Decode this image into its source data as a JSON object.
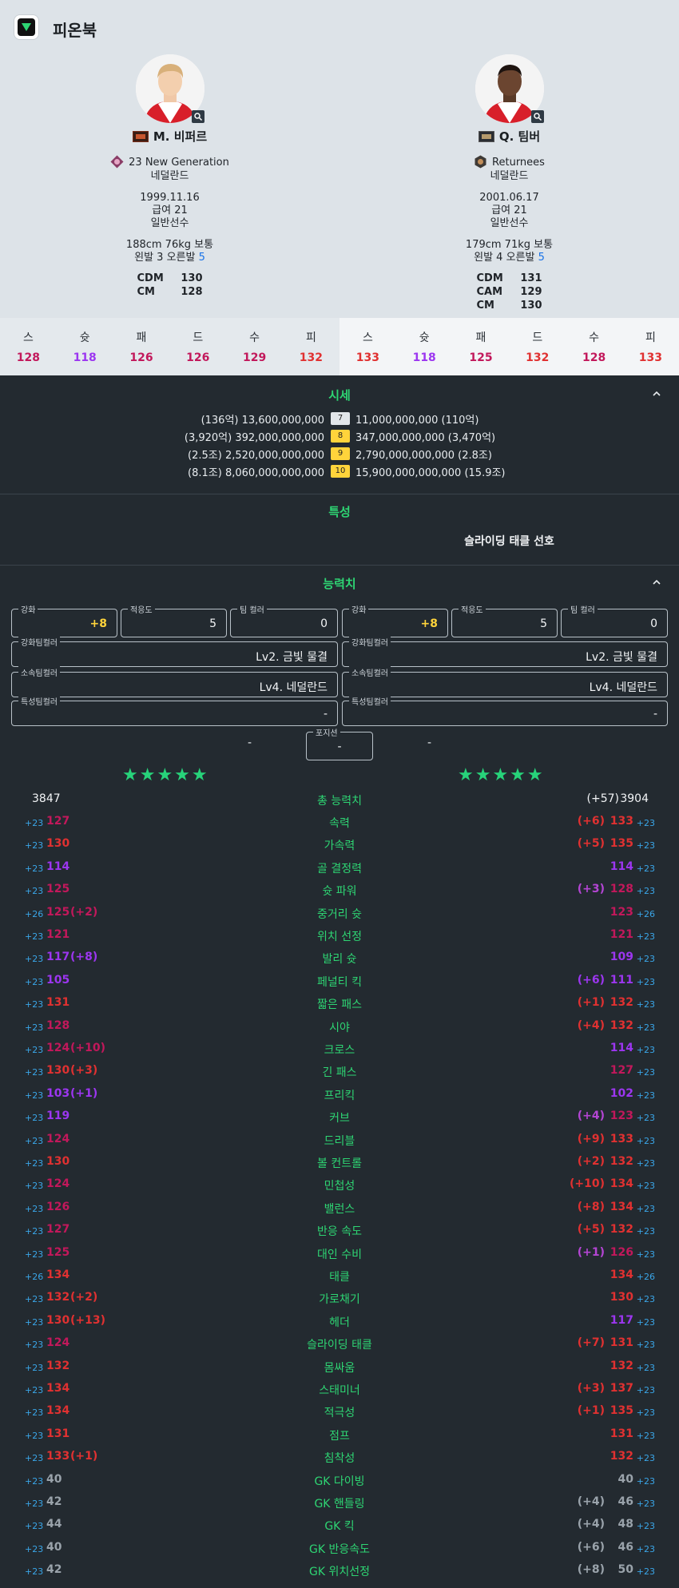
{
  "app": {
    "title": "피온북"
  },
  "colors": {
    "accent": "#2ed573",
    "red": "#e03131",
    "purple": "#b445d4",
    "pink": "#c2185b",
    "violet": "#9c36f0",
    "blue": "#3aa6e8",
    "yellow": "#ffd43b"
  },
  "players": [
    {
      "name": "M. 비퍼르",
      "season": "23 New Generation",
      "nation": "네덜란드",
      "birth": "1999.11.16",
      "salary": "급여 21",
      "grade": "일반선수",
      "body": "188cm 76kg 보통",
      "foot_prefix": "왼발 3 오른발",
      "foot_strong": "5",
      "positions": [
        {
          "pos": "CDM",
          "ovr": "130"
        },
        {
          "pos": "CM",
          "ovr": "128"
        }
      ],
      "stats": [
        {
          "label": "스",
          "value": "128",
          "color": "#c2185b"
        },
        {
          "label": "슛",
          "value": "118",
          "color": "#9c36f0"
        },
        {
          "label": "패",
          "value": "126",
          "color": "#c2185b"
        },
        {
          "label": "드",
          "value": "126",
          "color": "#c2185b"
        },
        {
          "label": "수",
          "value": "129",
          "color": "#c2185b"
        },
        {
          "label": "피",
          "value": "132",
          "color": "#e03131"
        }
      ]
    },
    {
      "name": "Q. 팀버",
      "season": "Returnees",
      "nation": "네덜란드",
      "birth": "2001.06.17",
      "salary": "급여 21",
      "grade": "일반선수",
      "body": "179cm 71kg 보통",
      "foot_prefix": "왼발 4 오른발",
      "foot_strong": "5",
      "positions": [
        {
          "pos": "CDM",
          "ovr": "131"
        },
        {
          "pos": "CAM",
          "ovr": "129"
        },
        {
          "pos": "CM",
          "ovr": "130"
        }
      ],
      "stats": [
        {
          "label": "스",
          "value": "133",
          "color": "#e03131"
        },
        {
          "label": "슛",
          "value": "118",
          "color": "#9c36f0"
        },
        {
          "label": "패",
          "value": "125",
          "color": "#c2185b"
        },
        {
          "label": "드",
          "value": "132",
          "color": "#e03131"
        },
        {
          "label": "수",
          "value": "128",
          "color": "#c2185b"
        },
        {
          "label": "피",
          "value": "133",
          "color": "#e03131"
        }
      ]
    }
  ],
  "price": {
    "title": "시세",
    "rows": [
      {
        "left": "(136억) 13,600,000,000",
        "level": "7",
        "right": "11,000,000,000 (110억)"
      },
      {
        "left": "(3,920억) 392,000,000,000",
        "level": "8",
        "right": "347,000,000,000 (3,470억)"
      },
      {
        "left": "(2.5조) 2,520,000,000,000",
        "level": "9",
        "right": "2,790,000,000,000 (2.8조)"
      },
      {
        "left": "(8.1조) 8,060,000,000,000",
        "level": "10",
        "right": "15,900,000,000,000 (15.9조)"
      }
    ]
  },
  "traits": {
    "title": "특성",
    "right_trait": "슬라이딩 태클 선호"
  },
  "abilities": {
    "title": "능력치",
    "fields": {
      "enhance_label": "강화",
      "enhance_value": "+8",
      "adapt_label": "적응도",
      "adapt_value": "5",
      "teamcolor_label": "팀 컬러",
      "teamcolor_value": "0",
      "enh_team_label": "강화팀컬러",
      "enh_team_value": "Lv2. 금빛 물결",
      "club_team_label": "소속팀컬러",
      "club_team_value": "Lv4. 네덜란드",
      "trait_team_label": "특성팀컬러",
      "trait_team_value": "-",
      "position_label": "포지션",
      "position_value": "-",
      "side_value": "-"
    },
    "stars": "★★★★★",
    "total": {
      "label": "총 능력치",
      "left": "3847",
      "right_bonus": "(+57)",
      "right": "3904"
    },
    "rows": [
      {
        "name": "속력",
        "lp": "+23",
        "lv": "127",
        "lc": "#c2185b",
        "lb": "",
        "lbc": "",
        "rb": "(+6)",
        "rbc": "#e03131",
        "rv": "133",
        "rc": "#e03131",
        "rp": "+23"
      },
      {
        "name": "가속력",
        "lp": "+23",
        "lv": "130",
        "lc": "#e03131",
        "lb": "",
        "lbc": "",
        "rb": "(+5)",
        "rbc": "#e03131",
        "rv": "135",
        "rc": "#e03131",
        "rp": "+23"
      },
      {
        "name": "골 결정력",
        "lp": "+23",
        "lv": "114",
        "lc": "#9c36f0",
        "lb": "",
        "lbc": "",
        "rb": "",
        "rbc": "",
        "rv": "114",
        "rc": "#9c36f0",
        "rp": "+23"
      },
      {
        "name": "슛 파워",
        "lp": "+23",
        "lv": "125",
        "lc": "#c2185b",
        "lb": "",
        "lbc": "",
        "rb": "(+3)",
        "rbc": "#b445d4",
        "rv": "128",
        "rc": "#c2185b",
        "rp": "+23"
      },
      {
        "name": "중거리 슛",
        "lp": "+26",
        "lv": "125",
        "lc": "#c2185b",
        "lb": "(+2)",
        "lbc": "#c2185b",
        "rb": "",
        "rbc": "",
        "rv": "123",
        "rc": "#c2185b",
        "rp": "+26"
      },
      {
        "name": "위치 선정",
        "lp": "+23",
        "lv": "121",
        "lc": "#c2185b",
        "lb": "",
        "lbc": "",
        "rb": "",
        "rbc": "",
        "rv": "121",
        "rc": "#c2185b",
        "rp": "+23"
      },
      {
        "name": "발리 슛",
        "lp": "+23",
        "lv": "117",
        "lc": "#9c36f0",
        "lb": "(+8)",
        "lbc": "#9c36f0",
        "rb": "",
        "rbc": "",
        "rv": "109",
        "rc": "#9c36f0",
        "rp": "+23"
      },
      {
        "name": "페널티 킥",
        "lp": "+23",
        "lv": "105",
        "lc": "#9c36f0",
        "lb": "",
        "lbc": "",
        "rb": "(+6)",
        "rbc": "#9c36f0",
        "rv": "111",
        "rc": "#9c36f0",
        "rp": "+23"
      },
      {
        "name": "짧은 패스",
        "lp": "+23",
        "lv": "131",
        "lc": "#e03131",
        "lb": "",
        "lbc": "",
        "rb": "(+1)",
        "rbc": "#e03131",
        "rv": "132",
        "rc": "#e03131",
        "rp": "+23"
      },
      {
        "name": "시야",
        "lp": "+23",
        "lv": "128",
        "lc": "#c2185b",
        "lb": "",
        "lbc": "",
        "rb": "(+4)",
        "rbc": "#e03131",
        "rv": "132",
        "rc": "#e03131",
        "rp": "+23"
      },
      {
        "name": "크로스",
        "lp": "+23",
        "lv": "124",
        "lc": "#c2185b",
        "lb": "(+10)",
        "lbc": "#c2185b",
        "rb": "",
        "rbc": "",
        "rv": "114",
        "rc": "#9c36f0",
        "rp": "+23"
      },
      {
        "name": "긴 패스",
        "lp": "+23",
        "lv": "130",
        "lc": "#e03131",
        "lb": "(+3)",
        "lbc": "#e03131",
        "rb": "",
        "rbc": "",
        "rv": "127",
        "rc": "#c2185b",
        "rp": "+23"
      },
      {
        "name": "프리킥",
        "lp": "+23",
        "lv": "103",
        "lc": "#9c36f0",
        "lb": "(+1)",
        "lbc": "#9c36f0",
        "rb": "",
        "rbc": "",
        "rv": "102",
        "rc": "#9c36f0",
        "rp": "+23"
      },
      {
        "name": "커브",
        "lp": "+23",
        "lv": "119",
        "lc": "#9c36f0",
        "lb": "",
        "lbc": "",
        "rb": "(+4)",
        "rbc": "#b445d4",
        "rv": "123",
        "rc": "#c2185b",
        "rp": "+23"
      },
      {
        "name": "드리블",
        "lp": "+23",
        "lv": "124",
        "lc": "#c2185b",
        "lb": "",
        "lbc": "",
        "rb": "(+9)",
        "rbc": "#e03131",
        "rv": "133",
        "rc": "#e03131",
        "rp": "+23"
      },
      {
        "name": "볼 컨트롤",
        "lp": "+23",
        "lv": "130",
        "lc": "#e03131",
        "lb": "",
        "lbc": "",
        "rb": "(+2)",
        "rbc": "#e03131",
        "rv": "132",
        "rc": "#e03131",
        "rp": "+23"
      },
      {
        "name": "민첩성",
        "lp": "+23",
        "lv": "124",
        "lc": "#c2185b",
        "lb": "",
        "lbc": "",
        "rb": "(+10)",
        "rbc": "#e03131",
        "rv": "134",
        "rc": "#e03131",
        "rp": "+23"
      },
      {
        "name": "밸런스",
        "lp": "+23",
        "lv": "126",
        "lc": "#c2185b",
        "lb": "",
        "lbc": "",
        "rb": "(+8)",
        "rbc": "#e03131",
        "rv": "134",
        "rc": "#e03131",
        "rp": "+23"
      },
      {
        "name": "반응 속도",
        "lp": "+23",
        "lv": "127",
        "lc": "#c2185b",
        "lb": "",
        "lbc": "",
        "rb": "(+5)",
        "rbc": "#e03131",
        "rv": "132",
        "rc": "#e03131",
        "rp": "+23"
      },
      {
        "name": "대인 수비",
        "lp": "+23",
        "lv": "125",
        "lc": "#c2185b",
        "lb": "",
        "lbc": "",
        "rb": "(+1)",
        "rbc": "#b445d4",
        "rv": "126",
        "rc": "#c2185b",
        "rp": "+23"
      },
      {
        "name": "태클",
        "lp": "+26",
        "lv": "134",
        "lc": "#e03131",
        "lb": "",
        "lbc": "",
        "rb": "",
        "rbc": "",
        "rv": "134",
        "rc": "#e03131",
        "rp": "+26"
      },
      {
        "name": "가로채기",
        "lp": "+23",
        "lv": "132",
        "lc": "#e03131",
        "lb": "(+2)",
        "lbc": "#e03131",
        "rb": "",
        "rbc": "",
        "rv": "130",
        "rc": "#e03131",
        "rp": "+23"
      },
      {
        "name": "헤더",
        "lp": "+23",
        "lv": "130",
        "lc": "#e03131",
        "lb": "(+13)",
        "lbc": "#e03131",
        "rb": "",
        "rbc": "",
        "rv": "117",
        "rc": "#9c36f0",
        "rp": "+23"
      },
      {
        "name": "슬라이딩 태클",
        "lp": "+23",
        "lv": "124",
        "lc": "#c2185b",
        "lb": "",
        "lbc": "",
        "rb": "(+7)",
        "rbc": "#e03131",
        "rv": "131",
        "rc": "#e03131",
        "rp": "+23"
      },
      {
        "name": "몸싸움",
        "lp": "+23",
        "lv": "132",
        "lc": "#e03131",
        "lb": "",
        "lbc": "",
        "rb": "",
        "rbc": "",
        "rv": "132",
        "rc": "#e03131",
        "rp": "+23"
      },
      {
        "name": "스태미너",
        "lp": "+23",
        "lv": "134",
        "lc": "#e03131",
        "lb": "",
        "lbc": "",
        "rb": "(+3)",
        "rbc": "#e03131",
        "rv": "137",
        "rc": "#e03131",
        "rp": "+23"
      },
      {
        "name": "적극성",
        "lp": "+23",
        "lv": "134",
        "lc": "#e03131",
        "lb": "",
        "lbc": "",
        "rb": "(+1)",
        "rbc": "#e03131",
        "rv": "135",
        "rc": "#e03131",
        "rp": "+23"
      },
      {
        "name": "점프",
        "lp": "+23",
        "lv": "131",
        "lc": "#e03131",
        "lb": "",
        "lbc": "",
        "rb": "",
        "rbc": "",
        "rv": "131",
        "rc": "#e03131",
        "rp": "+23"
      },
      {
        "name": "침착성",
        "lp": "+23",
        "lv": "133",
        "lc": "#e03131",
        "lb": "(+1)",
        "lbc": "#e03131",
        "rb": "",
        "rbc": "",
        "rv": "132",
        "rc": "#e03131",
        "rp": "+23"
      },
      {
        "name": "GK 다이빙",
        "lp": "+23",
        "lv": "40",
        "lc": "#9aa3ab",
        "lb": "",
        "lbc": "",
        "rb": "",
        "rbc": "",
        "rv": "40",
        "rc": "#9aa3ab",
        "rp": "+23"
      },
      {
        "name": "GK 핸들링",
        "lp": "+23",
        "lv": "42",
        "lc": "#9aa3ab",
        "lb": "",
        "lbc": "",
        "rb": "(+4)",
        "rbc": "#9aa3ab",
        "rv": "46",
        "rc": "#9aa3ab",
        "rp": "+23"
      },
      {
        "name": "GK 킥",
        "lp": "+23",
        "lv": "44",
        "lc": "#9aa3ab",
        "lb": "",
        "lbc": "",
        "rb": "(+4)",
        "rbc": "#9aa3ab",
        "rv": "48",
        "rc": "#9aa3ab",
        "rp": "+23"
      },
      {
        "name": "GK 반응속도",
        "lp": "+23",
        "lv": "40",
        "lc": "#9aa3ab",
        "lb": "",
        "lbc": "",
        "rb": "(+6)",
        "rbc": "#9aa3ab",
        "rv": "46",
        "rc": "#9aa3ab",
        "rp": "+23"
      },
      {
        "name": "GK 위치선정",
        "lp": "+23",
        "lv": "42",
        "lc": "#9aa3ab",
        "lb": "",
        "lbc": "",
        "rb": "(+8)",
        "rbc": "#9aa3ab",
        "rv": "50",
        "rc": "#9aa3ab",
        "rp": "+23"
      }
    ]
  }
}
